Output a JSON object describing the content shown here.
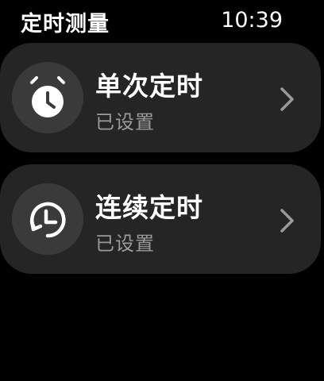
{
  "header": {
    "title": "定时测量",
    "time": "10:39"
  },
  "items": [
    {
      "title": "单次定时",
      "subtitle": "已设置",
      "icon": "alarm-clock-icon"
    },
    {
      "title": "连续定时",
      "subtitle": "已设置",
      "icon": "repeat-clock-icon"
    }
  ],
  "colors": {
    "background": "#000000",
    "card": "#252525",
    "icon_circle": "#3a3a3a",
    "subtitle": "#9a9a9a",
    "chevron": "#9a9a9a"
  }
}
